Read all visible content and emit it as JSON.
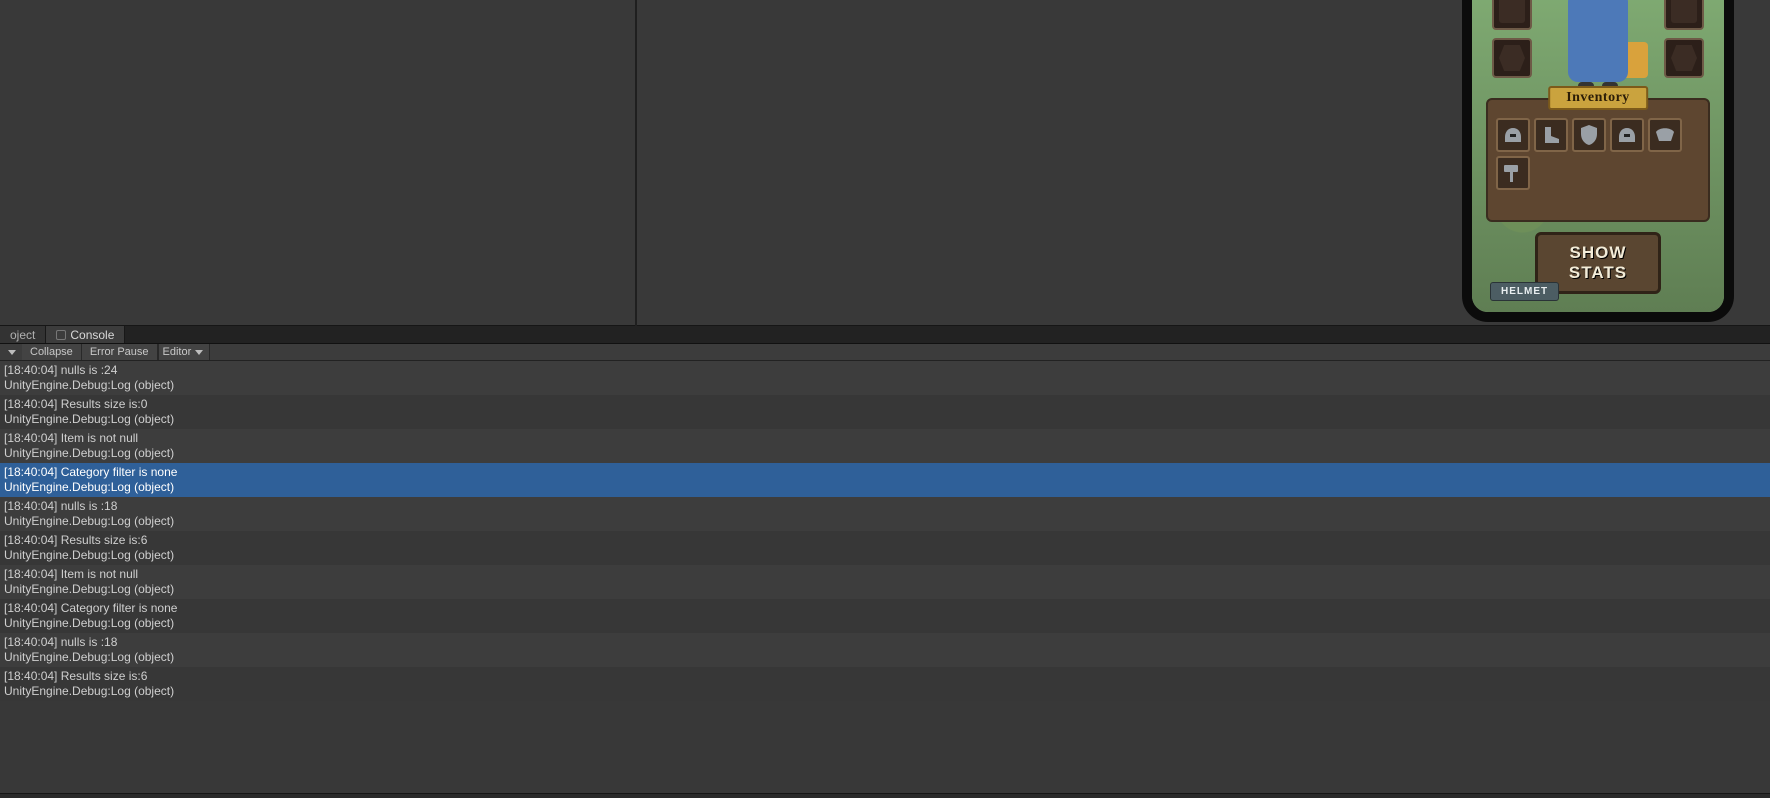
{
  "tabs": {
    "project": "oject",
    "console": "Console"
  },
  "toolbar": {
    "collapse": "Collapse",
    "error_pause": "Error Pause",
    "editor": "Editor"
  },
  "logs": [
    {
      "ts": "[18:40:04]",
      "msg": "nulls is :24",
      "src": "UnityEngine.Debug:Log (object)",
      "selected": false
    },
    {
      "ts": "[18:40:04]",
      "msg": "Results size is:0",
      "src": "UnityEngine.Debug:Log (object)",
      "selected": false
    },
    {
      "ts": "[18:40:04]",
      "msg": "Item is not null",
      "src": "UnityEngine.Debug:Log (object)",
      "selected": false
    },
    {
      "ts": "[18:40:04]",
      "msg": "Category filter is none",
      "src": "UnityEngine.Debug:Log (object)",
      "selected": true
    },
    {
      "ts": "[18:40:04]",
      "msg": "nulls is :18",
      "src": "UnityEngine.Debug:Log (object)",
      "selected": false
    },
    {
      "ts": "[18:40:04]",
      "msg": "Results size is:6",
      "src": "UnityEngine.Debug:Log (object)",
      "selected": false
    },
    {
      "ts": "[18:40:04]",
      "msg": "Item is not null",
      "src": "UnityEngine.Debug:Log (object)",
      "selected": false
    },
    {
      "ts": "[18:40:04]",
      "msg": "Category filter is none",
      "src": "UnityEngine.Debug:Log (object)",
      "selected": false
    },
    {
      "ts": "[18:40:04]",
      "msg": "nulls is :18",
      "src": "UnityEngine.Debug:Log (object)",
      "selected": false
    },
    {
      "ts": "[18:40:04]",
      "msg": "Results size is:6",
      "src": "UnityEngine.Debug:Log (object)",
      "selected": false
    }
  ],
  "game": {
    "inventory_label": "Inventory",
    "show_stats_label": "SHOW STATS",
    "helmet_chip": "HELMET",
    "inventory_items": [
      "helmet",
      "boots",
      "shield",
      "helmet2",
      "pauldron",
      "hammer"
    ]
  }
}
